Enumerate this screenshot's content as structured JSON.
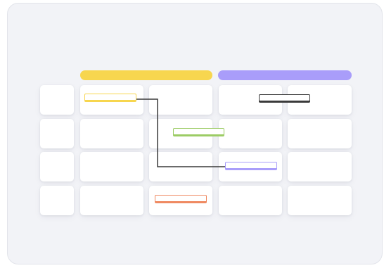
{
  "colors": {
    "panel_background": "#f2f3f7",
    "header_yellow": "#f7d64f",
    "header_purple": "#a99dfa",
    "connector_line": "#3a3a3a"
  },
  "header_bars": [
    {
      "name": "header-bar-yellow",
      "color": "#f7d64f"
    },
    {
      "name": "header-bar-purple",
      "color": "#a99dfa"
    }
  ],
  "grid": {
    "rows": 4,
    "columns": 5
  },
  "tasks": [
    {
      "name": "task-bar-yellow",
      "color": "#f7d64f",
      "row": 1,
      "column": 2
    },
    {
      "name": "task-bar-dark",
      "color": "#3a3a3a",
      "row": 1,
      "column": 4
    },
    {
      "name": "task-bar-green",
      "color": "#9ccc65",
      "row": 2,
      "column": 3
    },
    {
      "name": "task-bar-purple",
      "color": "#a99dfa",
      "row": 3,
      "column": 4
    },
    {
      "name": "task-bar-orange",
      "color": "#ef8a62",
      "row": 4,
      "column": 3
    }
  ],
  "connectors": [
    {
      "from": "task-bar-yellow",
      "to": "task-bar-purple"
    }
  ]
}
